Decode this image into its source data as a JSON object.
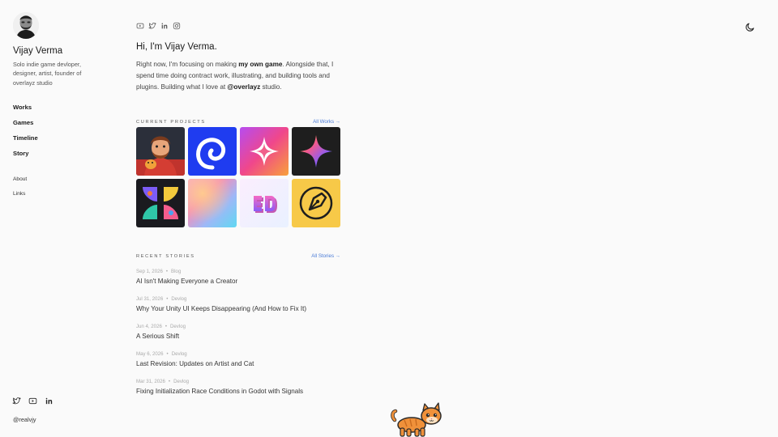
{
  "profile": {
    "name": "Vijay Verma",
    "bio": "Solo indie game devloper, designer, artist, founder of overlayz studio",
    "handle": "@realvjy"
  },
  "nav": {
    "main": [
      "Works",
      "Games",
      "Timeline",
      "Story"
    ],
    "secondary": [
      "About",
      "Links"
    ]
  },
  "social_top": [
    "youtube-icon",
    "twitter-icon",
    "linkedin-icon",
    "instagram-icon"
  ],
  "social_side": [
    "twitter-icon",
    "youtube-icon",
    "linkedin-icon"
  ],
  "theme_toggle_icon": "moon-icon",
  "intro": {
    "greeting": "Hi, I'm Vijay Verma.",
    "p1": "Right now, I'm focusing on making ",
    "p1_bold": "my own game",
    "p2": ". Alongside that, I spend time doing contract work, illustrating, and building tools and plugins. Building what I love at ",
    "p2_bold": "@overlayz",
    "p3": " studio."
  },
  "projects": {
    "title": "CURRENT PROJECTS",
    "link": "All Works →",
    "items": [
      "portrait-illustration",
      "swirl-logo",
      "sparkle-app-icon",
      "gradient-star",
      "butterfly-pattern",
      "gradient-blur",
      "3d-text",
      "pen-tool-icon"
    ]
  },
  "stories": {
    "title": "RECENT STORIES",
    "link": "All Stories →",
    "items": [
      {
        "date": "Sep 1, 2026",
        "category": "Blog",
        "title": "AI Isn't Making Everyone a Creator"
      },
      {
        "date": "Jul 31, 2026",
        "category": "Devlog",
        "title": "Why Your Unity UI Keeps Disappearing (And How to Fix It)"
      },
      {
        "date": "Jun 4, 2026",
        "category": "Devlog",
        "title": "A Serious Shift"
      },
      {
        "date": "May 6, 2026",
        "category": "Devlog",
        "title": "Last Revision: Updates on Artist and Cat"
      },
      {
        "date": "Mar 31, 2026",
        "category": "Devlog",
        "title": "Fixing Initialization Race Conditions in Godot with Signals"
      }
    ]
  },
  "colors": {
    "background": "#fafafa",
    "link": "#4a7bd6",
    "text": "#1a1a1a"
  }
}
